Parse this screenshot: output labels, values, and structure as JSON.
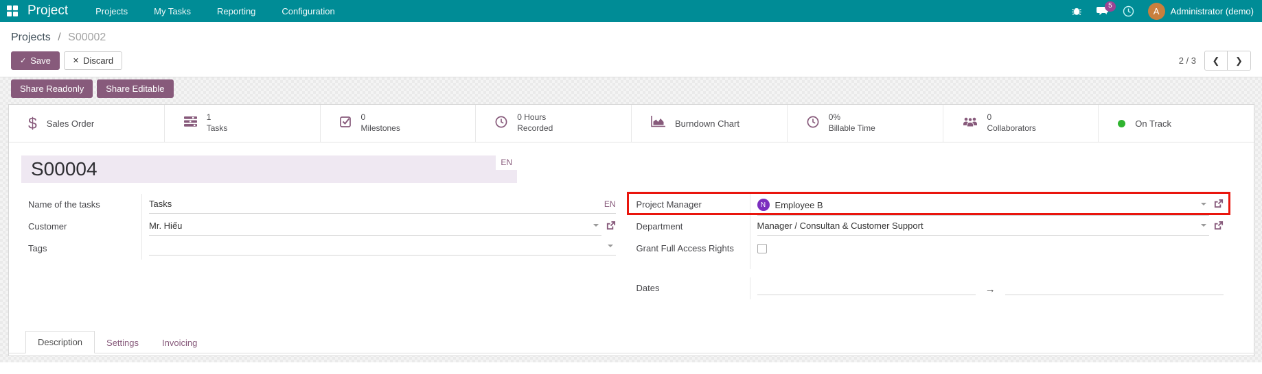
{
  "nav": {
    "brand": "Project",
    "items": [
      "Projects",
      "My Tasks",
      "Reporting",
      "Configuration"
    ],
    "message_count": "5",
    "user_name": "Administrator (demo)",
    "user_initial": "A"
  },
  "breadcrumb": {
    "parent": "Projects",
    "separator": "/",
    "current": "S00002"
  },
  "controls": {
    "save_label": "Save",
    "save_glyph": "✓",
    "discard_label": "Discard",
    "discard_glyph": "✕",
    "pager": "2 / 3",
    "prev_glyph": "❮",
    "next_glyph": "❯"
  },
  "share": {
    "readonly_label": "Share Readonly",
    "editable_label": "Share Editable"
  },
  "stats": {
    "sales_order": "Sales Order",
    "tasks_count": "1",
    "tasks_label": "Tasks",
    "milestones_count": "0",
    "milestones_label": "Milestones",
    "hours_count": "0 Hours",
    "hours_label": "Recorded",
    "burndown_label": "Burndown Chart",
    "billable_count": "0%",
    "billable_label": "Billable Time",
    "collab_count": "0",
    "collab_label": "Collaborators",
    "dollar_glyph": "$",
    "status_label": "On Track"
  },
  "form": {
    "title_value": "S00004",
    "title_lang": "EN",
    "name_label": "Name of the tasks",
    "name_value": "Tasks",
    "name_lang": "EN",
    "customer_label": "Customer",
    "customer_value": "Mr. Hiếu",
    "tags_label": "Tags",
    "pm_label": "Project Manager",
    "pm_value": "Employee B",
    "pm_avatar_initial": "N",
    "dept_label": "Department",
    "dept_value": "Manager / Consultan & Customer Support",
    "grant_label": "Grant Full Access Rights",
    "dates_label": "Dates",
    "dates_arrow": "→"
  },
  "tabs": {
    "description": "Description",
    "settings": "Settings",
    "invoicing": "Invoicing"
  },
  "colors": {
    "nav_teal": "#008c96",
    "accent_purple": "#875a7b",
    "annotation_red": "#e9150d",
    "status_green": "#30b430",
    "pm_avatar_purple": "#7b2fbf",
    "user_avatar_orange": "#c87f3e",
    "message_badge": "#9b4493",
    "title_field_bg": "#efe8f2"
  }
}
